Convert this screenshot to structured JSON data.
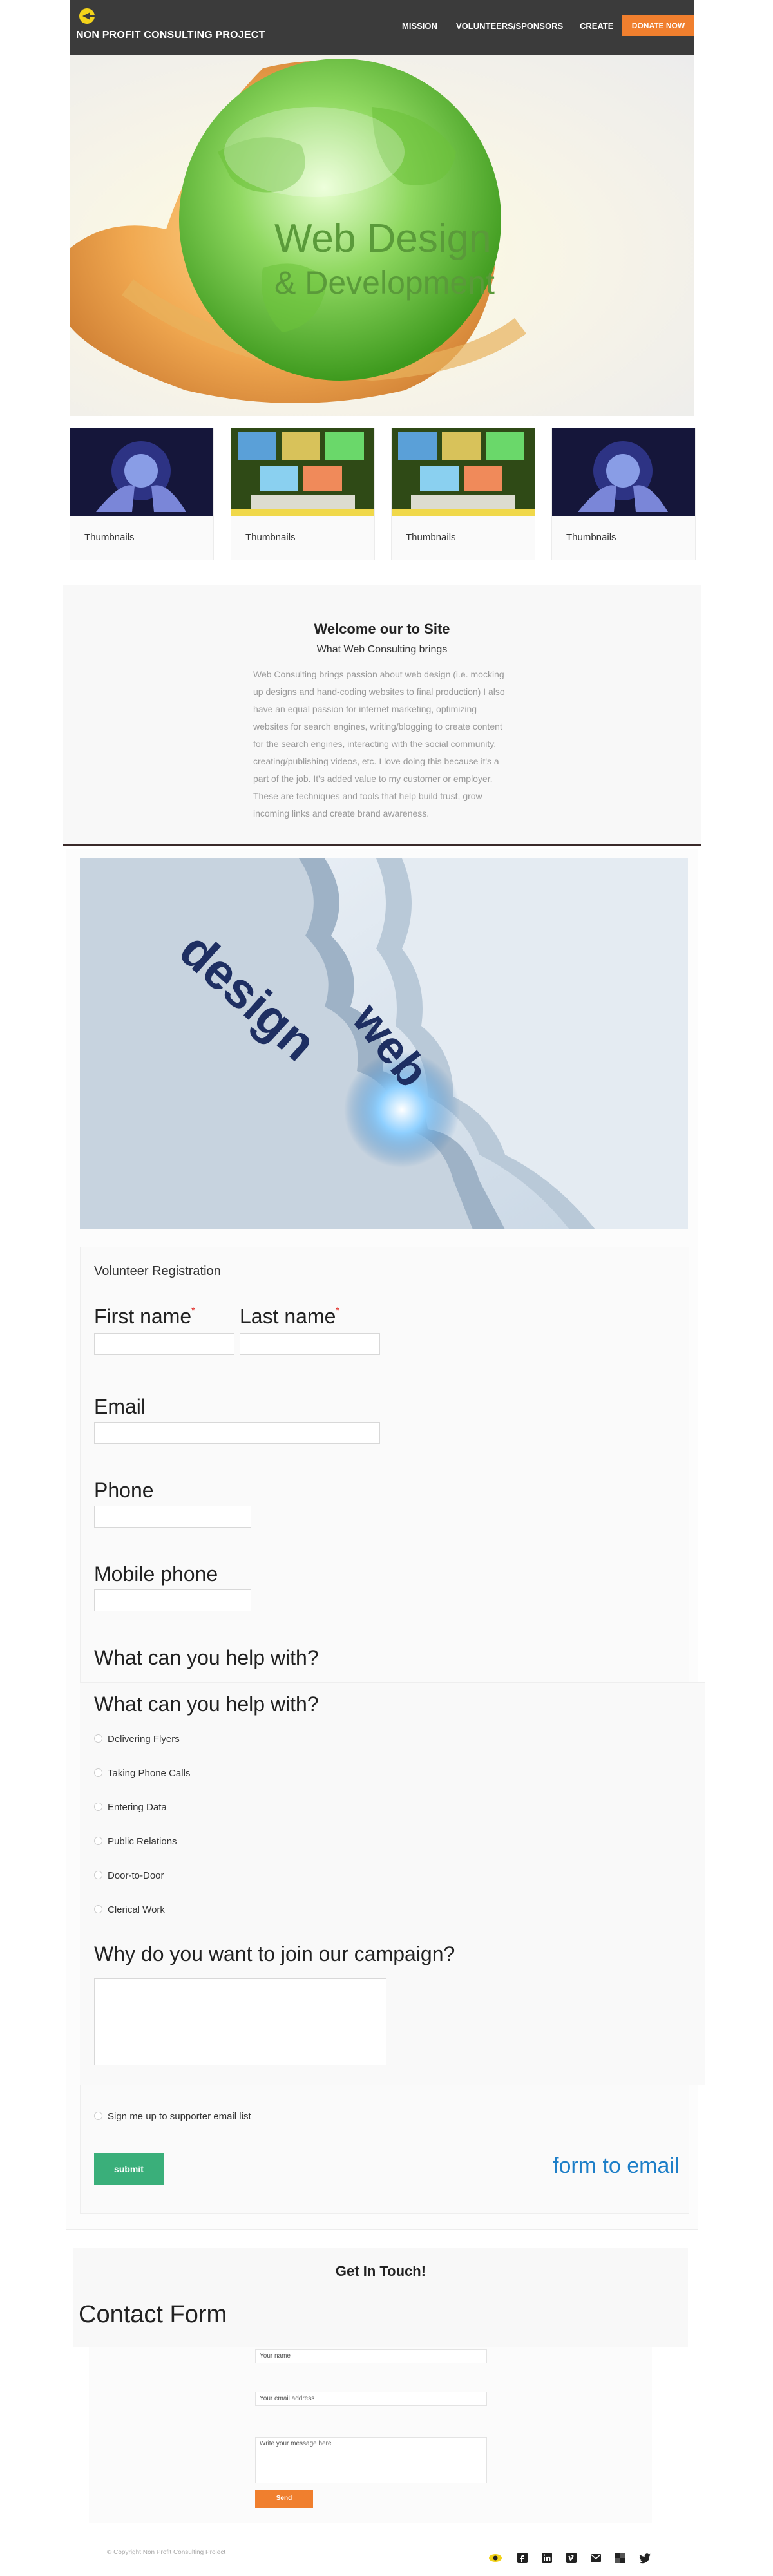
{
  "header": {
    "brand": "NON PROFIT CONSULTING PROJECT",
    "nav": [
      "MISSION",
      "VOLUNTEERS/SPONSORS",
      "CREATE"
    ],
    "donate_label": "DONATE NOW",
    "accent_color": "#f07f2e"
  },
  "hero": {
    "line1": "Web Design",
    "line2": "& Development"
  },
  "thumbnails": [
    {
      "caption": "Thumbnails",
      "icon": "globe-hands-image"
    },
    {
      "caption": "Thumbnails",
      "icon": "laptop-screens-image"
    },
    {
      "caption": "Thumbnails",
      "icon": "laptop-screens-image"
    },
    {
      "caption": "Thumbnails",
      "icon": "globe-hands-image"
    }
  ],
  "welcome": {
    "title": "Welcome our to Site",
    "subtitle": "What Web Consulting brings",
    "body": "Web Consulting brings passion about web design (i.e. mocking up designs and hand-coding websites to final production) I also have an equal passion for internet marketing, optimizing websites for search engines, writing/blogging to create content for the search engines, interacting with the social community, creating/publishing videos, etc. I love doing this because it's a part of the job. It's added value to my customer or employer. These are techniques and tools that help build trust, grow incoming links and create brand awareness."
  },
  "gear_image": {
    "word1": "design",
    "word2": "web"
  },
  "form": {
    "title": "Volunteer Registration",
    "first_name_label": "First name",
    "last_name_label": "Last name",
    "required_mark": "*",
    "email_label": "Email",
    "phone_label": "Phone",
    "mobile_label": "Mobile phone",
    "help_label_ghost": "What can you help with?",
    "help_label": "What can you help with?",
    "options": [
      "Delivering Flyers",
      "Taking Phone Calls",
      "Entering Data",
      "Public Relations",
      "Door-to-Door",
      "Clerical Work"
    ],
    "why_label": "Why do you want to join our campaign?",
    "signup_label": "Sign me up to supporter email list",
    "submit_label": "submit",
    "form_to_email": "form to email"
  },
  "contact": {
    "title": "Get In Touch!",
    "form_title": "Contact Form",
    "name_placeholder": "Your name",
    "email_placeholder": "Your email address",
    "message_placeholder": "Write your message here",
    "send_label": "Send"
  },
  "footer": {
    "copyright": "© Copyright Non Profit Consulting Project",
    "social_icons": [
      "eye-icon",
      "facebook-icon",
      "linkedin-icon",
      "vimeo-icon",
      "email-icon",
      "delicious-icon",
      "twitter-icon"
    ]
  }
}
